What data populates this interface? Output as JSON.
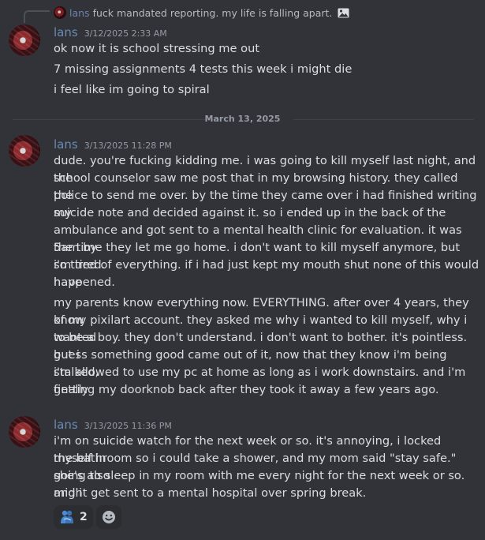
{
  "reply": {
    "username": "lans",
    "text": "fuck mandated reporting. my life is falling apart.",
    "attachment_icon": "image-icon"
  },
  "messages": [
    {
      "username": "lans",
      "timestamp": "3/12/2025 2:33 AM",
      "lines": [
        "ok now it is school stressing me out",
        "7 missing assignments 4 tests this week i might die",
        "i feel like im going to spiral"
      ]
    },
    {
      "username": "lans",
      "timestamp": "3/13/2025 11:28 PM",
      "lines": [
        "dude. you're fucking kidding me. i was going to kill myself last night, and the",
        "school counselor saw me post that in my browsing history. they called the",
        "police to send me over. by the time they came over i had finished writing my",
        "suicide note and decided against it. so i ended up in the back of the",
        "ambulance and got sent to a mental health clinic for evaluation. it was 5am by",
        "the time they let me go home. i don't want to kill myself anymore, but i'm tired.",
        "so tired of everything. if i had just kept my mouth shut none of this would have",
        "happened."
      ],
      "lines2": [
        "my parents know everything now. EVERYTHING. after over 4 years, they know",
        "of my pixilart account. they asked me why i wanted to kill myself, why i wanted",
        "to be a boy. they don't understand. i don't want to bother. it's pointless. but i",
        "guess something good came out of it, now that they know i'm being stalked,",
        "i'm allowed to use my pc at home as long as i work downstairs. and i'm finally",
        "getting my doorknob back after they took it away a few years ago."
      ]
    },
    {
      "username": "lans",
      "timestamp": "3/13/2025 11:36 PM",
      "lines": [
        "i'm on suicide watch for the next week or so. it's annoying, i locked myself in",
        "the bathroom so i could take a shower, and my mom said \"stay safe.\" she's also",
        "going to sleep in my room with me every night for the next week or so. and i",
        "might get sent to a mental hospital over spring break."
      ]
    }
  ],
  "date_divider": "March 13, 2025",
  "reactions": [
    {
      "icon": "people-hugging-emoji",
      "count": "2"
    }
  ],
  "add_reaction_icon": "smiley-add-reaction-icon"
}
